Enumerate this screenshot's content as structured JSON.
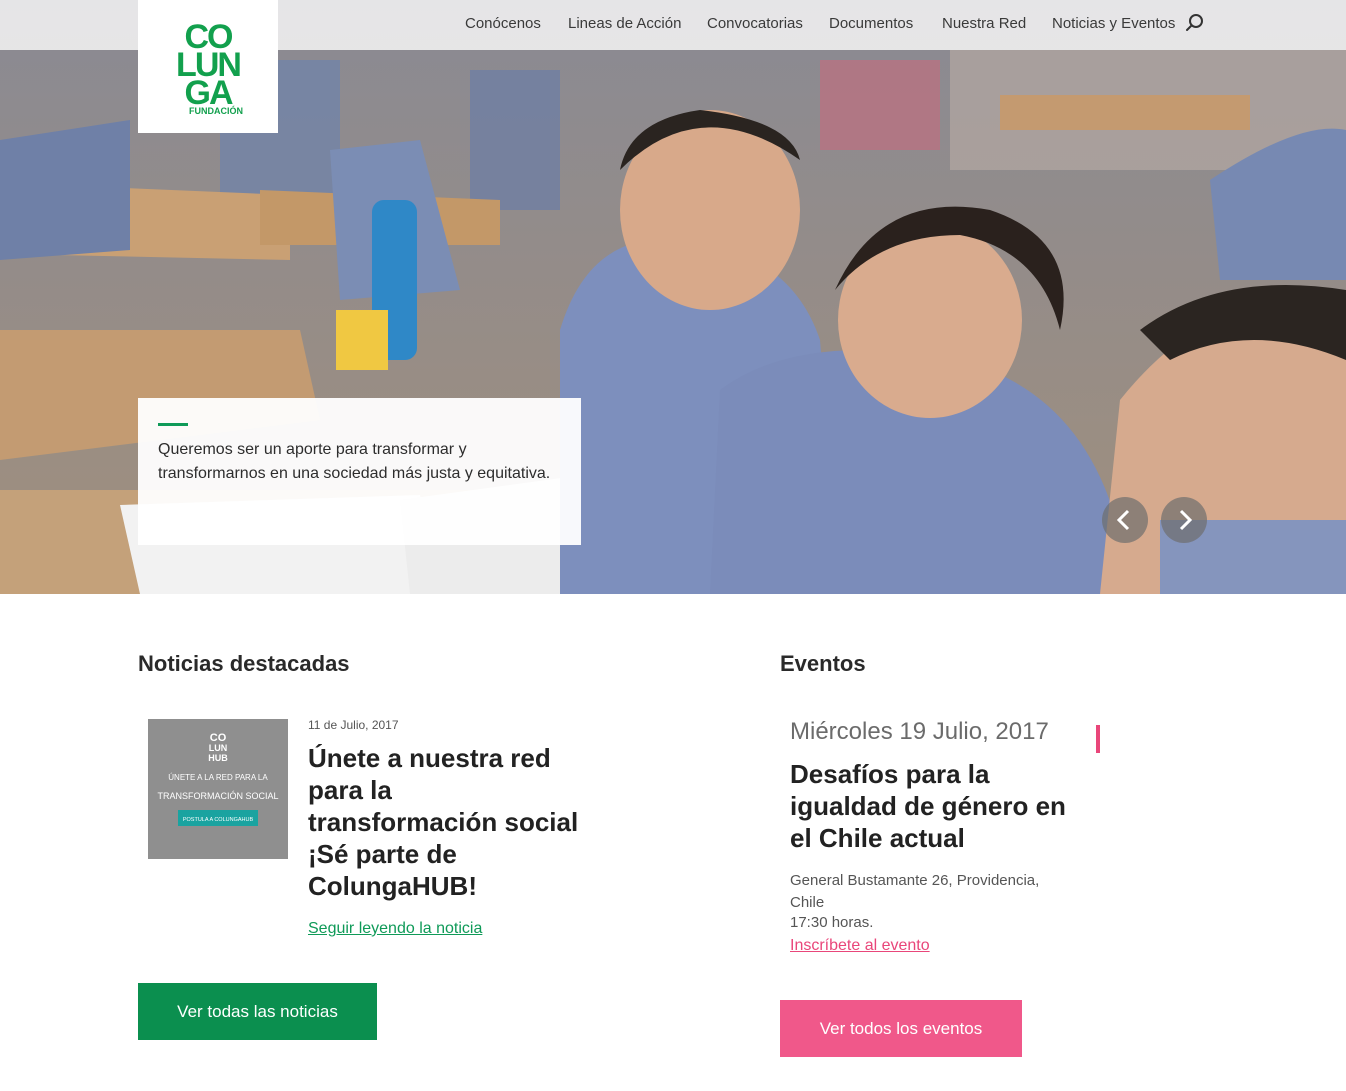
{
  "brand": {
    "logo_letters": [
      "CO",
      "LUN",
      "GA"
    ],
    "logo_sub": "FUNDACIÓN",
    "accent_green": "#0b8f4f",
    "accent_pink": "#f0588a"
  },
  "nav": {
    "items": [
      {
        "label": "Conócenos"
      },
      {
        "label": "Lineas de Acción"
      },
      {
        "label": "Convocatorias"
      },
      {
        "label": "Documentos"
      },
      {
        "label": "Nuestra Red"
      },
      {
        "label": "Noticias y Eventos"
      }
    ],
    "search_icon": "search-icon"
  },
  "hero": {
    "caption": "Queremos ser un aporte para transformar y transformarnos en una sociedad más justa y equitativa.",
    "prev_icon": "chevron-left-icon",
    "next_icon": "chevron-right-icon"
  },
  "news": {
    "heading": "Noticias destacadas",
    "thumb": {
      "logo_lines": [
        "CO",
        "LUN",
        "HUB"
      ],
      "text_lines": [
        "ÚNETE A LA RED PARA LA",
        "TRANSFORMACIÓN SOCIAL"
      ],
      "button": "POSTULA A COLUNGAHUB"
    },
    "date": "11 de Julio, 2017",
    "title": "Únete a nuestra red para la transformación social ¡Sé parte de ColungaHUB!",
    "link": "Seguir leyendo la noticia",
    "all_button": "Ver todas las noticias"
  },
  "events": {
    "heading": "Eventos",
    "date": "Miércoles 19 Julio, 2017",
    "title": "Desafíos para la igualdad de género en el Chile actual",
    "address": "General Bustamante 26, Providencia, Chile",
    "time": "17:30 horas.",
    "link": "Inscríbete al evento",
    "all_button": "Ver todos los eventos"
  }
}
